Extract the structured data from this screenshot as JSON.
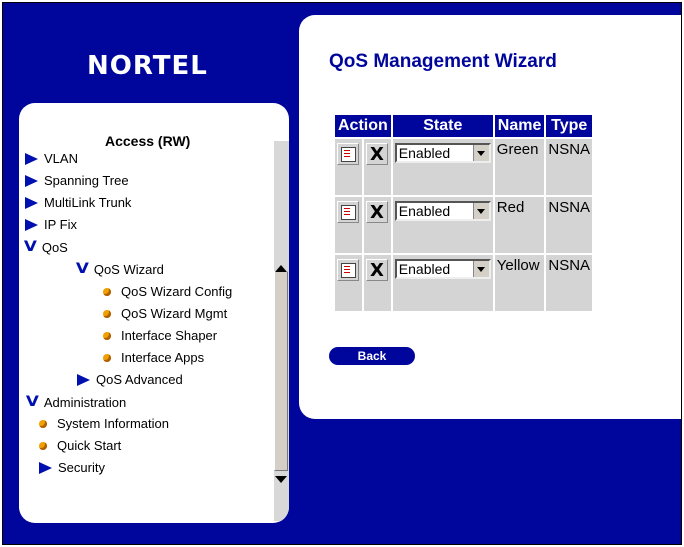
{
  "brand": {
    "logo_text": "NORTEL"
  },
  "nav": {
    "title": "Access (RW)",
    "items": [
      {
        "label": "VLAN"
      },
      {
        "label": "Spanning Tree"
      },
      {
        "label": "MultiLink Trunk"
      },
      {
        "label": "IP Fix"
      },
      {
        "label": "QoS"
      },
      {
        "label": "QoS Wizard"
      },
      {
        "label": "QoS Wizard Config"
      },
      {
        "label": "QoS Wizard Mgmt"
      },
      {
        "label": "Interface Shaper"
      },
      {
        "label": "Interface Apps"
      },
      {
        "label": "QoS Advanced"
      },
      {
        "label": "Administration"
      },
      {
        "label": "System Information"
      },
      {
        "label": "Quick Start"
      },
      {
        "label": "Security"
      }
    ]
  },
  "page": {
    "title": "QoS Management Wizard"
  },
  "table": {
    "headers": [
      "Action",
      "State",
      "Name",
      "Type"
    ],
    "rows": [
      {
        "state": "Enabled",
        "name": "Green",
        "type": "NSNA"
      },
      {
        "state": "Enabled",
        "name": "Red",
        "type": "NSNA"
      },
      {
        "state": "Enabled",
        "name": "Yellow",
        "type": "NSNA"
      }
    ]
  },
  "buttons": {
    "back": "Back"
  },
  "colors": {
    "brand_blue": "#00069c",
    "nav_arrow": "#0010b0",
    "bullet": "#f0a000"
  }
}
